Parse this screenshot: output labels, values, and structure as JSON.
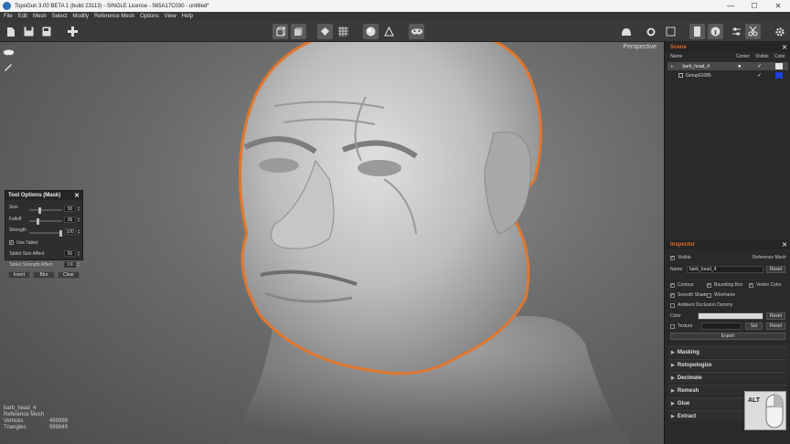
{
  "window": {
    "title": "TopoGun 3.00 BETA 1 (build 23113) - SINGLE License - 565A17C030 - untitled*",
    "controls": [
      "—",
      "☐",
      "✕"
    ]
  },
  "menu": [
    "File",
    "Edit",
    "Mesh",
    "Select",
    "Modify",
    "Reference Mesh",
    "Options",
    "View",
    "Help"
  ],
  "toolbar": {
    "left": [
      "new-file",
      "save",
      "save-as",
      "add"
    ],
    "center": [
      "cube-wire",
      "cube-solid",
      "reference-mesh",
      "grid-mesh",
      "sphere-shaded",
      "triangle-wire",
      "mask"
    ],
    "right": [
      "helmet",
      "gear-small",
      "frame",
      "info",
      "sliders",
      "scissors",
      "settings"
    ]
  },
  "viewport": {
    "camera_label": "Perspective"
  },
  "tool_options": {
    "title": "Tool Options (Mask)",
    "size_label": "Size",
    "size_value": "50",
    "falloff_label": "Falloff",
    "falloff_value": "36",
    "strength_label": "Strength",
    "strength_value": "100",
    "use_tablet_label": "Use Tablet",
    "tablet_size_label": "Tablet Size Affect",
    "tablet_size_value": "50",
    "tablet_strength_label": "Tablet Strength Affect",
    "tablet_strength_value": "100",
    "invert_label": "Invert",
    "blur_label": "Blur",
    "clear_label": "Clear",
    "size_level": 0.3,
    "falloff_level": 0.25,
    "strength_level": 1.0
  },
  "mesh_info": {
    "name": "barb_head_4",
    "type": "Reference Mesh",
    "vertices_label": "Vertices",
    "vertices_value": "499999",
    "triangles_label": "Triangles",
    "triangles_value": "999849"
  },
  "scene": {
    "title": "Scene",
    "columns": {
      "name": "Name",
      "center": "Center",
      "visible": "Visible",
      "color": "Color"
    },
    "rows": [
      {
        "name": "barb_head_4",
        "center": "●",
        "visible": "✓",
        "color": "#e6e6e6"
      },
      {
        "name": "Group01085",
        "center": "",
        "visible": "✓",
        "color": "#1f3fd8"
      }
    ]
  },
  "inspector": {
    "title": "Inspector",
    "visible_label": "Visible",
    "ref_mesh_label": "Reference Mesh",
    "name_label": "Name",
    "name_value": "barb_head_4",
    "reset_label": "Reset",
    "contour_label": "Contour",
    "bounding_box_label": "Bounding Box",
    "vertex_color_label": "Vertex Color",
    "smooth_shade_label": "Smooth Shade",
    "wireframe_label": "Wireframe",
    "ao_label": "Ambient Occlusion Dummy",
    "color_label": "Color",
    "texture_label": "Texture",
    "set_label": "Set",
    "export_label": "Export"
  },
  "sections": [
    "Masking",
    "Retopologize",
    "Decimate",
    "Remesh",
    "Glue",
    "Extract"
  ],
  "alt_indicator": "ALT"
}
